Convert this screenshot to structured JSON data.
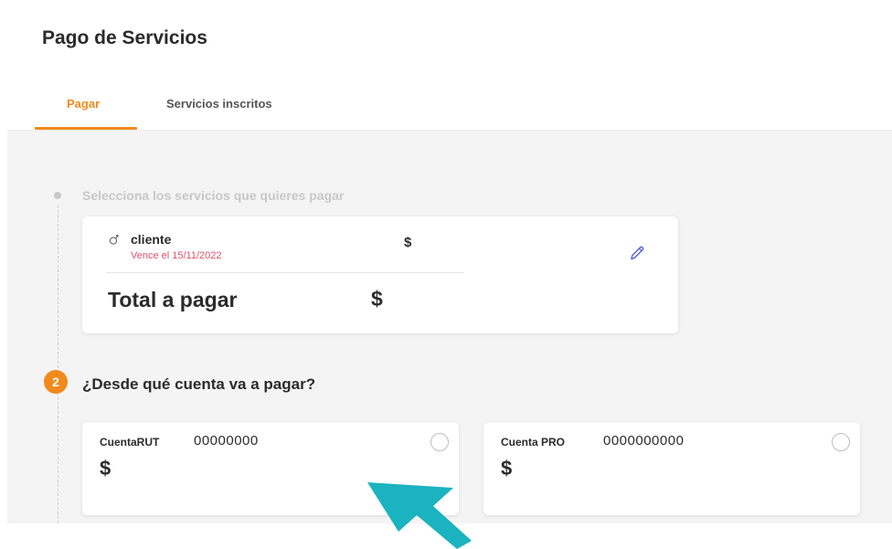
{
  "page": {
    "title": "Pago de Servicios"
  },
  "tabs": [
    {
      "label": "Pagar",
      "active": true
    },
    {
      "label": "Servicios inscritos",
      "active": false
    }
  ],
  "step1": {
    "label": "Selecciona los servicios que quieres pagar",
    "service": {
      "icon": "person-icon",
      "name": "cliente",
      "due": "Vence el 15/11/2022",
      "amount": "$",
      "edit_icon": "pencil-icon"
    },
    "total_label": "Total a pagar",
    "total_amount": "$"
  },
  "step2": {
    "number": "2",
    "label": "¿Desde qué cuenta va a pagar?",
    "accounts": [
      {
        "name": "CuentaRUT",
        "number": "00000000",
        "balance": "$",
        "selected": false
      },
      {
        "name": "Cuenta PRO",
        "number": "0000000000",
        "balance": "$",
        "selected": false
      }
    ]
  },
  "colors": {
    "accent": "#f08a1c",
    "due_text": "#e0526a",
    "background": "#f4f4f4",
    "pointer": "#1ab3bf"
  }
}
